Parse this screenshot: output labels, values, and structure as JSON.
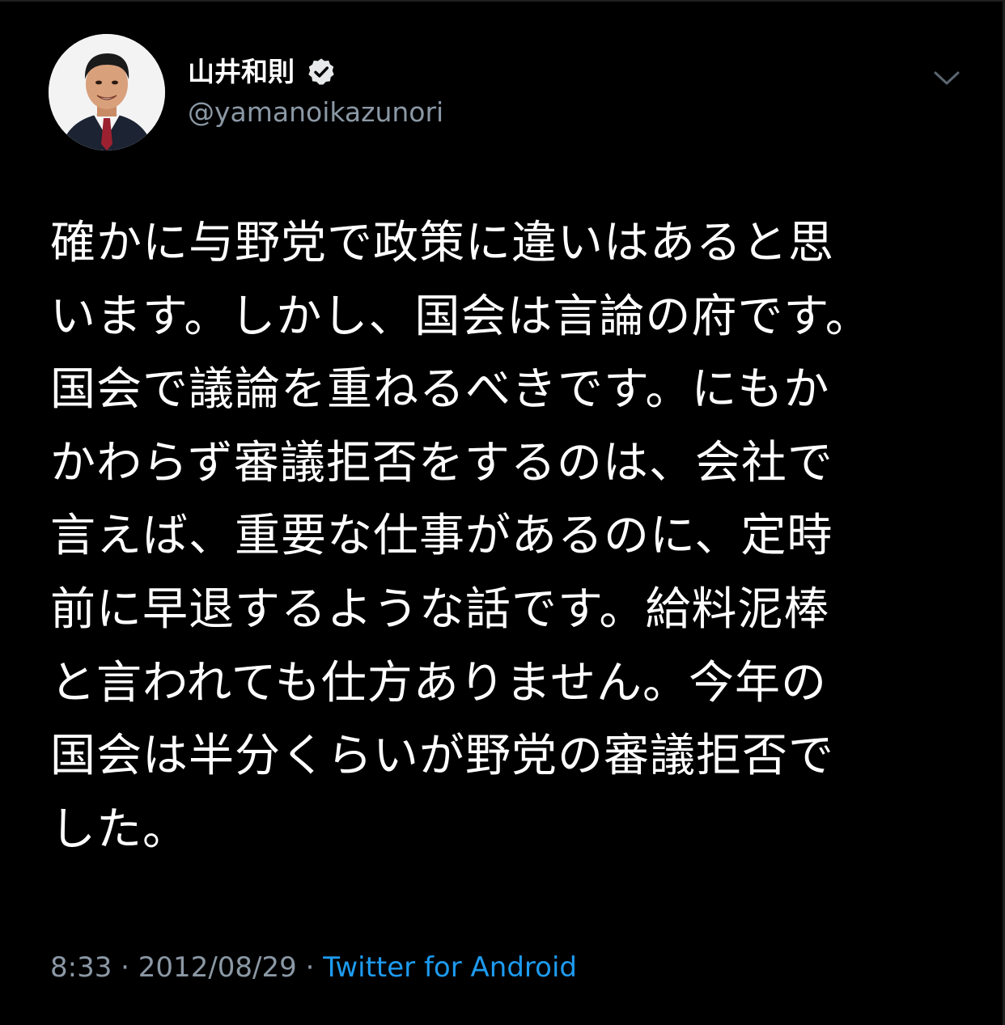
{
  "author": {
    "display_name": "山井和則",
    "handle": "@yamanoikazunori",
    "verified": true,
    "avatar_icon": "profile-photo"
  },
  "tweet": {
    "text": "確かに与野党で政策に違いはあると思\nいます。しかし、国会は言論の府です。\n国会で議論を重ねるべきです。にもか\nかわらず審議拒否をするのは、会社で\n言えば、重要な仕事があるのに、定時\n前に早退するような話です。給料泥棒\nと言われても仕方ありません。今年の\n国会は半分くらいが野党の審議拒否で\nした。"
  },
  "meta": {
    "time": "8:33",
    "separator": " · ",
    "date": "2012/08/29",
    "source": "Twitter for Android"
  },
  "colors": {
    "background": "#000000",
    "text": "#ffffff",
    "secondary": "#8b98a5",
    "link": "#1d9bf0"
  },
  "icons": {
    "verified": "verified-badge-icon",
    "menu": "chevron-down-icon"
  }
}
